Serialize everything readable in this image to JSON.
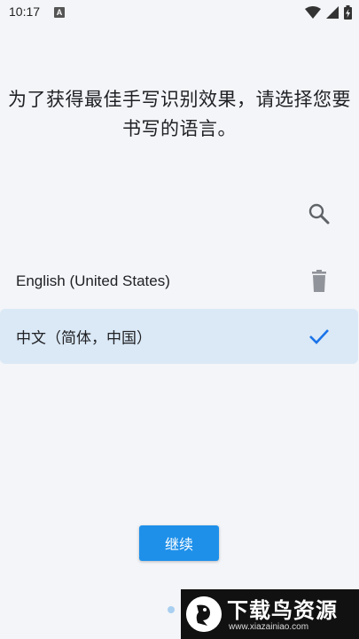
{
  "status_bar": {
    "time": "10:17",
    "notification_letter": "A",
    "icons": [
      "wifi-icon",
      "cellular-signal-icon",
      "battery-charging-icon"
    ]
  },
  "prompt": {
    "line1": "为了获得最佳手写识别效果，请选择您要",
    "line2": "书写的语言。"
  },
  "toolbar": {
    "search_icon": "search-icon"
  },
  "languages": [
    {
      "label": "English (United States)",
      "action_icon": "trash-icon",
      "selected": false
    },
    {
      "label": "中文（简体，中国）",
      "action_icon": "checkmark-icon",
      "selected": true
    }
  ],
  "continue_label": "继续",
  "pager": {
    "total_visible": 2,
    "active_index": 0
  },
  "watermark": {
    "title": "下载鸟资源",
    "url": "www.xiazainiao.com"
  },
  "colors": {
    "background": "#f3f5f8",
    "accent": "#1e90ea",
    "selected_row": "#dbe9f6",
    "check": "#1a73e8"
  }
}
